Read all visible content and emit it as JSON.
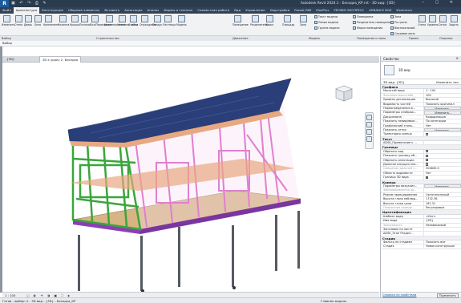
{
  "app": {
    "title": "Autodesk Revit 2024.1 - Беседка_КР.rvt - 3D вид: {3D}",
    "app_button": "R"
  },
  "ribbon_tabs": [
    "Файл",
    "Архитектура",
    "Конструкция",
    "Сборные элементы",
    "Вставить",
    "Аннотация",
    "Анализ",
    "Формы и генплан",
    "Совместная работа",
    "Вид",
    "Управление",
    "Надстройки",
    "Pozzat BIM",
    "ModPlus",
    "PROBIM ЭКСПРЕСС",
    "ARBANCE BOX",
    "Изменить"
  ],
  "ribbon": {
    "tools": [
      "Изменить",
      "Стена",
      "Дверь",
      "Окно",
      "Компонент",
      "Колонна",
      "Крыша",
      "Потолок",
      "Пол/Перекрытие",
      "Навесная стена",
      "Навесная сетка",
      "Стойка",
      "Ограждение",
      "Пандус",
      "Лестница",
      "Модель",
      "Помещение",
      "Разделитель",
      "Марка",
      "Площадь",
      "Зона",
      "Стена",
      "Уровень",
      "Сетка",
      "Задать"
    ],
    "small_tools": [
      "Текст модели",
      "Линия модели",
      "Группа модели",
      "Помещение",
      "Разделитель помещений",
      "Марка помещения",
      "Зона",
      "По грани",
      "Вертикальный",
      "Слуховое окно"
    ],
    "panels": [
      "Выбор",
      "Строительство",
      "Движение",
      "Модель",
      "Помещения и зоны",
      "Проем",
      "Опорная"
    ]
  },
  "options_bar": {
    "label": "Выбор"
  },
  "view_tabs": [
    {
      "label": "{3D}",
      "active": false
    },
    {
      "label": "3D к уроку 2. Беседка",
      "active": true
    }
  ],
  "view_bar": {
    "scale": "1 : 100"
  },
  "status_bar": {
    "text": "Готов - выбор: 0 - 3D вид - {3D} - Беседка_КР",
    "model": "Главная модель"
  },
  "properties": {
    "title": "Свойства",
    "type_name": "3D вид",
    "selector": "3D вид: {3D}",
    "edit_type": "Изменить тип",
    "groups": [
      {
        "name": "Графика",
        "rows": [
          [
            "Масштаб вида",
            "1 : 100",
            "v"
          ],
          [
            "Значение масштаба",
            "100",
            "d"
          ],
          [
            "Уровень детализации",
            "Высокий",
            "v"
          ],
          [
            "Видимость частей",
            "Показать оригинал",
            "v"
          ],
          [
            "Переопределения в...",
            "Изменить...",
            "b"
          ],
          [
            "Параметры отображ...",
            "Изменить...",
            "b"
          ],
          [
            "Дисциплина",
            "Координация",
            "v"
          ],
          [
            "Показать невидимые...",
            "По категории",
            "v"
          ],
          [
            "Графический стиль...",
            "Нет",
            "v"
          ],
          [
            "Показать сетки",
            "Изменить...",
            "b"
          ],
          [
            "Траектория солнца",
            "",
            "c0"
          ]
        ]
      },
      {
        "name": "Текст",
        "rows": [
          [
            "ADSK_Примечание к ...",
            "",
            "v"
          ]
        ]
      },
      {
        "name": "Границы",
        "rows": [
          [
            "Обрезать вид",
            "",
            "c0"
          ],
          [
            "Показать границу об...",
            "",
            "c0"
          ],
          [
            "Обрезать аннотации",
            "",
            "c0"
          ],
          [
            "Дальняя секущая пло...",
            "",
            "c0"
          ],
          [
            "Смещение дальней с...",
            "304800.0",
            "d"
          ],
          [
            "Область видимости",
            "Нет",
            "v"
          ],
          [
            "Граница 3D вида",
            "",
            "c1"
          ]
        ]
      },
      {
        "name": "Камера",
        "rows": [
          [
            "Параметры визуализ...",
            "Изменить...",
            "b"
          ],
          [
            "Заблокированная ор...",
            "",
            "d"
          ],
          [
            "Режим проецирования",
            "Ортогональный",
            "v"
          ],
          [
            "Высота глаза наблюд...",
            "1732.36",
            "v"
          ],
          [
            "Высота точки цели",
            "161.31",
            "v"
          ],
          [
            "Положение камеры",
            "Регулировка",
            "d"
          ]
        ]
      },
      {
        "name": "Идентификация",
        "rows": [
          [
            "Шаблон вида",
            "<Нет>",
            "v"
          ],
          [
            "Имя вида",
            "{3D}",
            "v"
          ],
          [
            "Зависимость",
            "Независимый",
            "d"
          ],
          [
            "Заголовок на листе",
            "",
            "v"
          ],
          [
            "ADSK_Этап Раздел...",
            "",
            "v"
          ]
        ]
      },
      {
        "name": "Стадии",
        "rows": [
          [
            "Фильтр по стадиям",
            "Показать все",
            "v"
          ],
          [
            "Стадия",
            "Новая конструкция",
            "v"
          ]
        ]
      }
    ],
    "help_link": "Справка по свойствам",
    "apply": "Применить"
  },
  "colors": {
    "title_bar": "#2b3b4e",
    "ribbon_tab_bar": "#2f4258",
    "roof": "#2a3f7a",
    "wall_frame": "#e07fcf",
    "end_frame": "#3aa63a",
    "floor": "#8c3fb5",
    "deck": "#d6b483",
    "top_plate": "#e8a882",
    "piles": "#555a60"
  }
}
